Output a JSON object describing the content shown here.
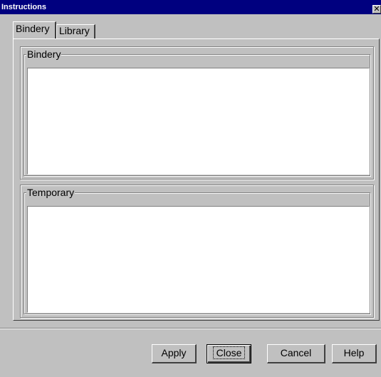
{
  "window": {
    "title": "Instructions",
    "close_glyph": "✕"
  },
  "tabs": [
    {
      "label": "Bindery",
      "selected": true
    },
    {
      "label": "Library",
      "selected": false
    }
  ],
  "groups": {
    "bindery": {
      "label": "Bindery",
      "value": ""
    },
    "temporary": {
      "label": "Temporary",
      "value": ""
    }
  },
  "buttons": {
    "apply": "Apply",
    "close": "Close",
    "cancel": "Cancel",
    "help": "Help"
  }
}
